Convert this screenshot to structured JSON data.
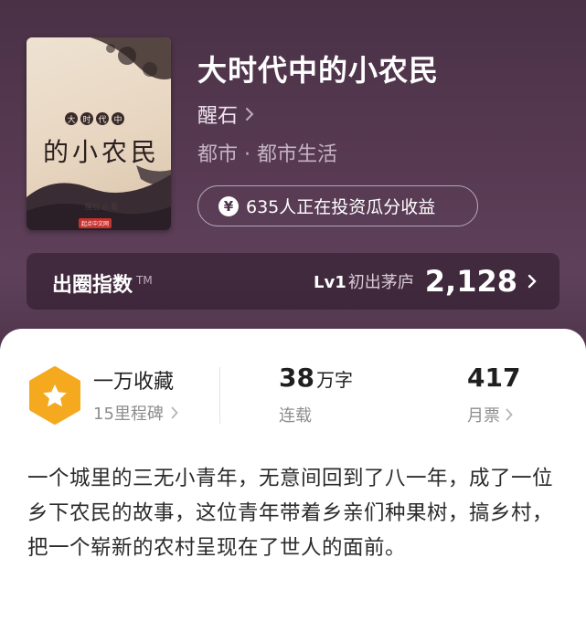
{
  "book": {
    "title": "大时代中的小农民",
    "author": "醒石",
    "genre": "都市 · 都市生活",
    "invest_text": "635人正在投资瓜分收益",
    "invest_icon": "yen-coin-icon"
  },
  "cover": {
    "small_chars": [
      "大",
      "时",
      "代",
      "中"
    ],
    "title": "的小农民",
    "author_line": "醒石 ◎ 著",
    "publisher_badge": "起点中文网"
  },
  "index_bar": {
    "label": "出圈指数",
    "tm": "TM",
    "level": "Lv1",
    "level_name": "初出茅庐",
    "score": "2,128"
  },
  "stats": {
    "collect_title": "一万收藏",
    "collect_sub": "15里程碑",
    "words_num": "38",
    "words_unit": "万字",
    "words_label": "连载",
    "tickets_num": "417",
    "tickets_label": "月票"
  },
  "description": "一个城里的三无小青年，无意间回到了八一年，成了一位乡下农民的故事，这位青年带着乡亲们种果树，搞乡村，把一个崭新的农村呈现在了世人的面前。",
  "colors": {
    "hero_bg": "#573a52",
    "accent_gold": "#f5a91f",
    "text_dark": "#1f1f1f",
    "text_muted": "#8e8e8e"
  }
}
